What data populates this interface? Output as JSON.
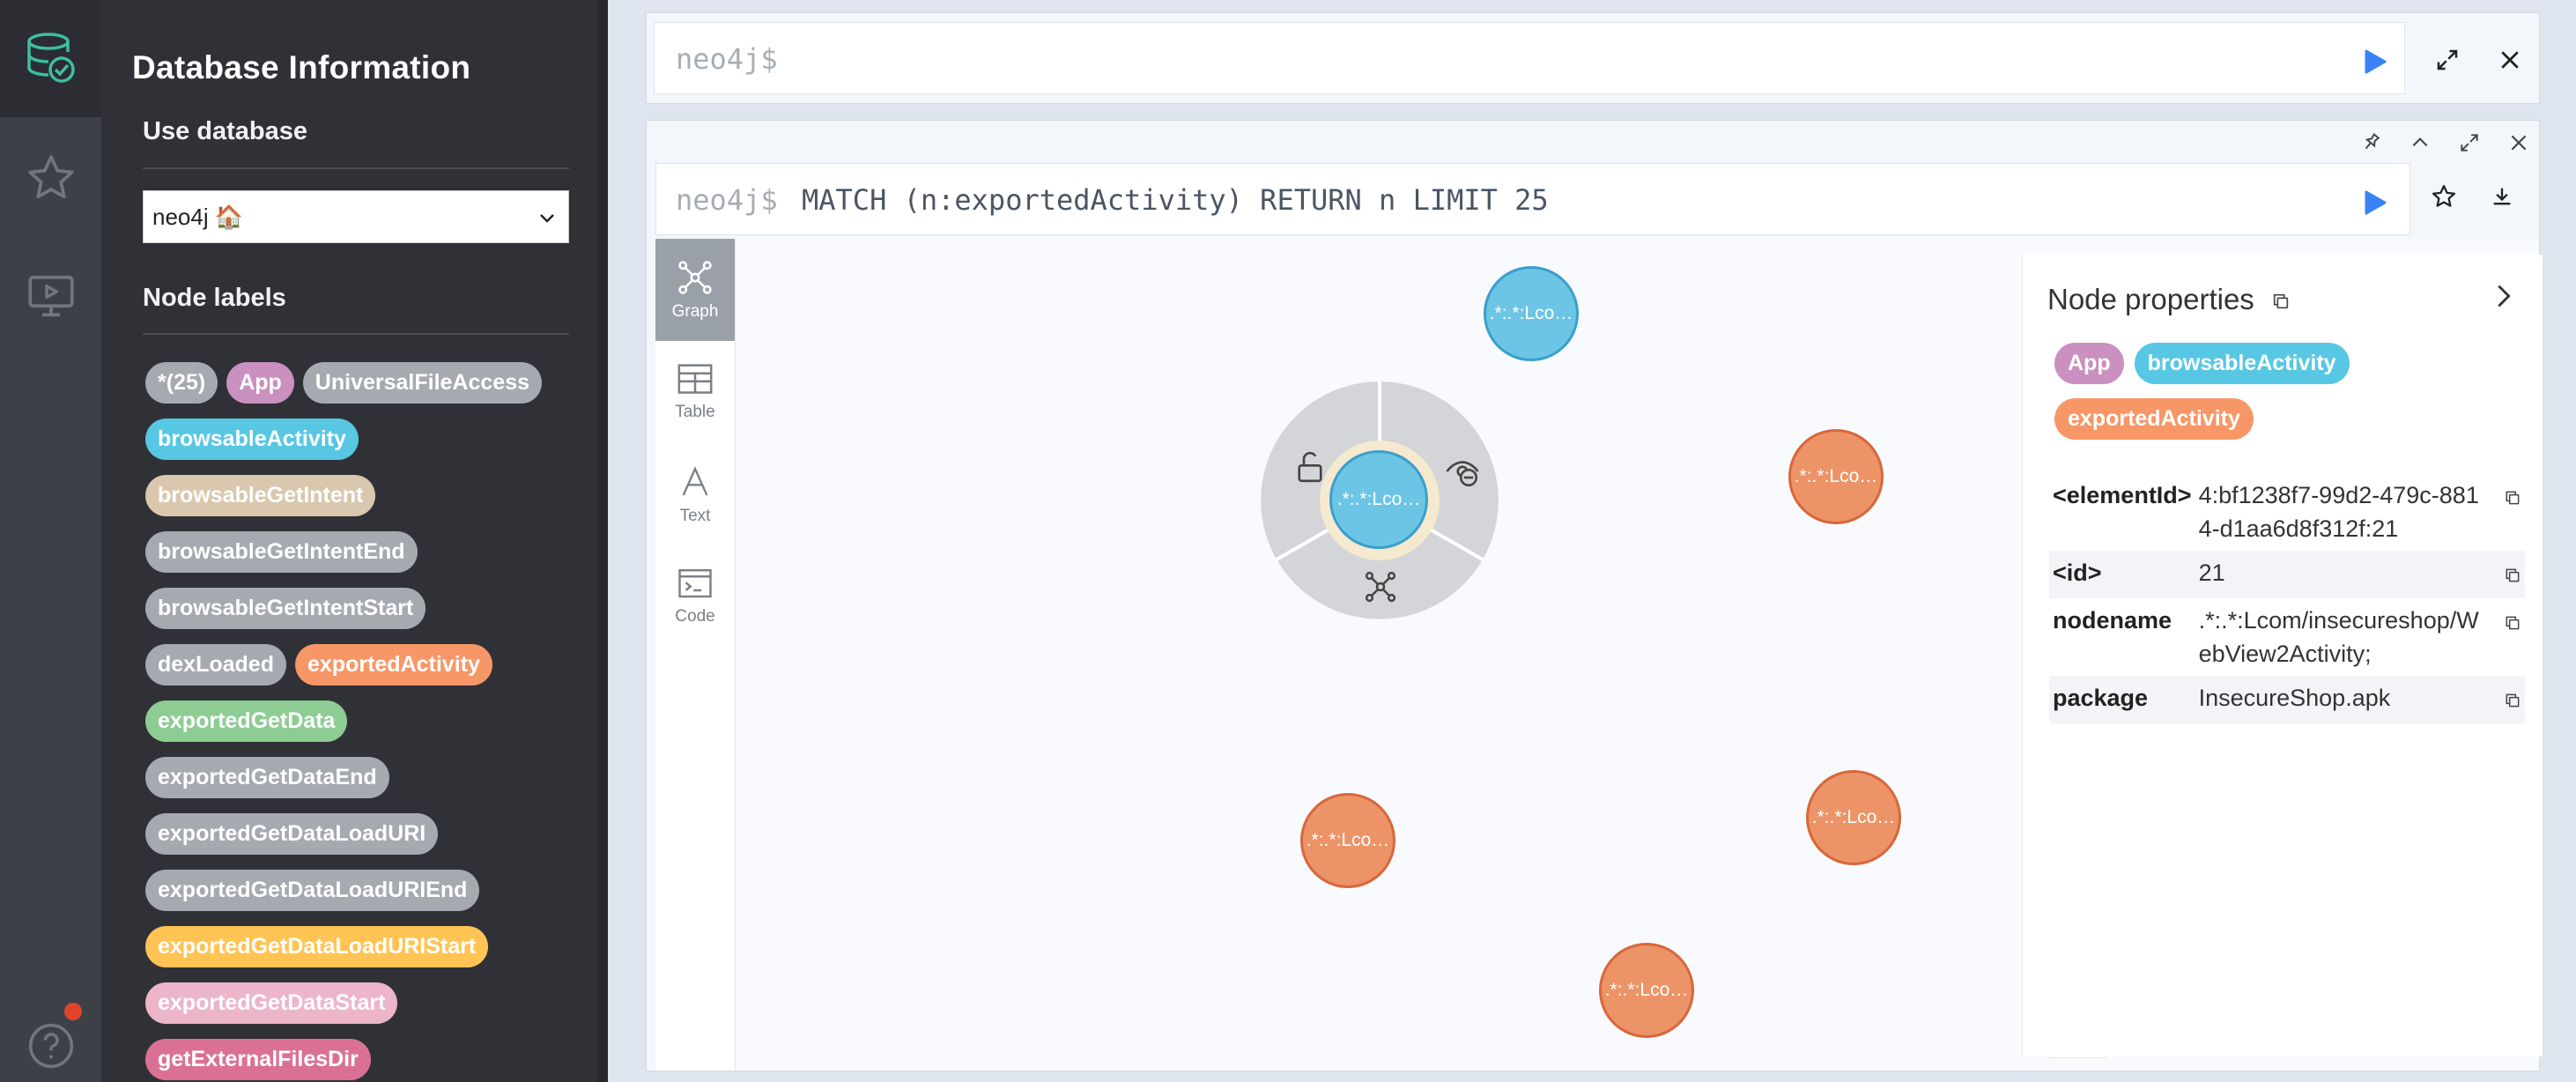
{
  "rail": {
    "icons": [
      "database-check-icon",
      "star-icon",
      "play-monitor-icon",
      "help-icon"
    ]
  },
  "drawer": {
    "title": "Database Information",
    "use_db_heading": "Use database",
    "db_selected": "neo4j 🏠",
    "node_labels_heading": "Node labels",
    "labels": [
      [
        {
          "text": "*(25)",
          "color": "#a5a9b0"
        },
        {
          "text": "App",
          "color": "#c990c0"
        },
        {
          "text": "UniversalFileAccess",
          "color": "#a5a9b0"
        }
      ],
      [
        {
          "text": "browsableActivity",
          "color": "#57c7e3"
        }
      ],
      [
        {
          "text": "browsableGetIntent",
          "color": "#d9c8ae"
        }
      ],
      [
        {
          "text": "browsableGetIntentEnd",
          "color": "#a5a9b0"
        }
      ],
      [
        {
          "text": "browsableGetIntentStart",
          "color": "#a5a9b0"
        }
      ],
      [
        {
          "text": "dexLoaded",
          "color": "#a5a9b0"
        },
        {
          "text": "exportedActivity",
          "color": "#f79767"
        }
      ],
      [
        {
          "text": "exportedGetData",
          "color": "#8dcc93"
        }
      ],
      [
        {
          "text": "exportedGetDataEnd",
          "color": "#a5a9b0"
        }
      ],
      [
        {
          "text": "exportedGetDataLoadURI",
          "color": "#a5a9b0"
        }
      ],
      [
        {
          "text": "exportedGetDataLoadURIEnd",
          "color": "#a5a9b0"
        }
      ],
      [
        {
          "text": "exportedGetDataLoadURIStart",
          "color": "#ffc454"
        }
      ],
      [
        {
          "text": "exportedGetDataStart",
          "color": "#ecb5c9"
        }
      ],
      [
        {
          "text": "getExternalFilesDir",
          "color": "#da7194"
        }
      ]
    ]
  },
  "editor": {
    "prompt": "neo4j$"
  },
  "frame": {
    "query_prompt": "neo4j$",
    "query_text": "MATCH (n:exportedActivity) RETURN n LIMIT 25",
    "tabs": [
      "Graph",
      "Table",
      "Text",
      "Code"
    ],
    "active_tab": "Graph",
    "nodes": [
      {
        "label": ".*:.*:Lco…",
        "kind": "blue",
        "selected": true
      },
      {
        "label": ".*:.*:Lco…",
        "kind": "blue"
      },
      {
        "label": ".*:.*:Lco…",
        "kind": "orange"
      },
      {
        "label": ".*:.*:Lco…",
        "kind": "orange"
      },
      {
        "label": ".*:.*:Lco…",
        "kind": "orange"
      },
      {
        "label": ".*:.*:Lco…",
        "kind": "orange"
      }
    ]
  },
  "properties": {
    "title": "Node properties",
    "labels": [
      {
        "text": "App",
        "color": "#c990c0"
      },
      {
        "text": "browsableActivity",
        "color": "#57c7e3"
      },
      {
        "text": "exportedActivity",
        "color": "#f79767"
      }
    ],
    "rows": [
      {
        "key": "<elementId>",
        "value": "4:bf1238f7-99d2-479c-8814-d1aa6d8f312f:21"
      },
      {
        "key": "<id>",
        "value": "21"
      },
      {
        "key": "nodename",
        "value": ".*:.*:Lcom/insecureshop/WebView2Activity;"
      },
      {
        "key": "package",
        "value": "InsecureShop.apk"
      }
    ]
  },
  "colors": {
    "accent_blue": "#3b82f6",
    "node_blue": "#6dc5e5",
    "node_orange": "#ec9468"
  }
}
